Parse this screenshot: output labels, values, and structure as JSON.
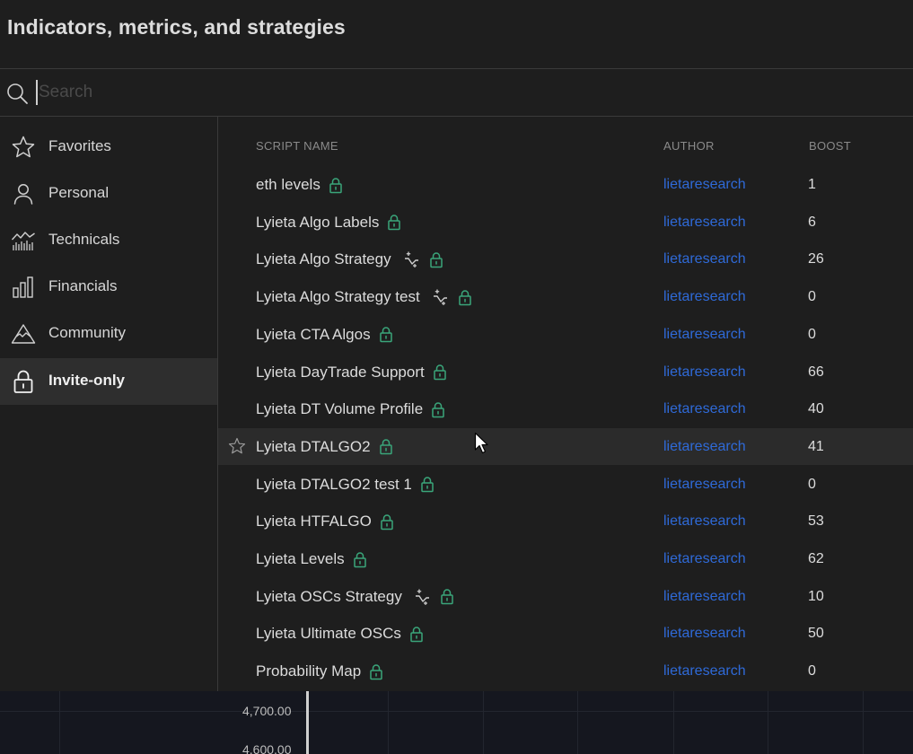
{
  "dialog": {
    "title": "Indicators, metrics, and strategies"
  },
  "search": {
    "placeholder": "Search",
    "value": ""
  },
  "sidebar": {
    "items": [
      {
        "label": "Favorites",
        "icon": "star-icon"
      },
      {
        "label": "Personal",
        "icon": "user-icon"
      },
      {
        "label": "Technicals",
        "icon": "technicals-chart-icon"
      },
      {
        "label": "Financials",
        "icon": "bar-chart-icon"
      },
      {
        "label": "Community",
        "icon": "community-mountain-icon"
      },
      {
        "label": "Invite-only",
        "icon": "lock-icon",
        "active": true
      }
    ]
  },
  "list": {
    "headers": {
      "name": "SCRIPT NAME",
      "author": "AUTHOR",
      "boost": "BOOST"
    },
    "rows": [
      {
        "name": "eth levels",
        "author": "lietaresearch",
        "boost": "1",
        "strategy": false
      },
      {
        "name": "Lyieta Algo Labels",
        "author": "lietaresearch",
        "boost": "6",
        "strategy": false
      },
      {
        "name": "Lyieta Algo Strategy",
        "author": "lietaresearch",
        "boost": "26",
        "strategy": true
      },
      {
        "name": "Lyieta Algo Strategy test",
        "author": "lietaresearch",
        "boost": "0",
        "strategy": true
      },
      {
        "name": "Lyieta CTA Algos",
        "author": "lietaresearch",
        "boost": "0",
        "strategy": false
      },
      {
        "name": "Lyieta DayTrade Support",
        "author": "lietaresearch",
        "boost": "66",
        "strategy": false
      },
      {
        "name": "Lyieta DT Volume Profile",
        "author": "lietaresearch",
        "boost": "40",
        "strategy": false
      },
      {
        "name": "Lyieta DTALGO2",
        "author": "lietaresearch",
        "boost": "41",
        "strategy": false,
        "hovered": true
      },
      {
        "name": "Lyieta DTALGO2 test 1",
        "author": "lietaresearch",
        "boost": "0",
        "strategy": false
      },
      {
        "name": "Lyieta HTFALGO",
        "author": "lietaresearch",
        "boost": "53",
        "strategy": false
      },
      {
        "name": "Lyieta Levels",
        "author": "lietaresearch",
        "boost": "62",
        "strategy": false
      },
      {
        "name": "Lyieta OSCs Strategy",
        "author": "lietaresearch",
        "boost": "10",
        "strategy": true
      },
      {
        "name": "Lyieta Ultimate OSCs",
        "author": "lietaresearch",
        "boost": "50",
        "strategy": false
      },
      {
        "name": "Probability Map",
        "author": "lietaresearch",
        "boost": "0",
        "strategy": false
      }
    ]
  },
  "chart": {
    "price_labels": [
      "4,700.00",
      "4,600.00"
    ]
  },
  "colors": {
    "author_link": "#2f6ad8",
    "lock_green": "#3aa57a",
    "panel_bg": "#1e1e1e",
    "active_bg": "#2e2e2e"
  }
}
